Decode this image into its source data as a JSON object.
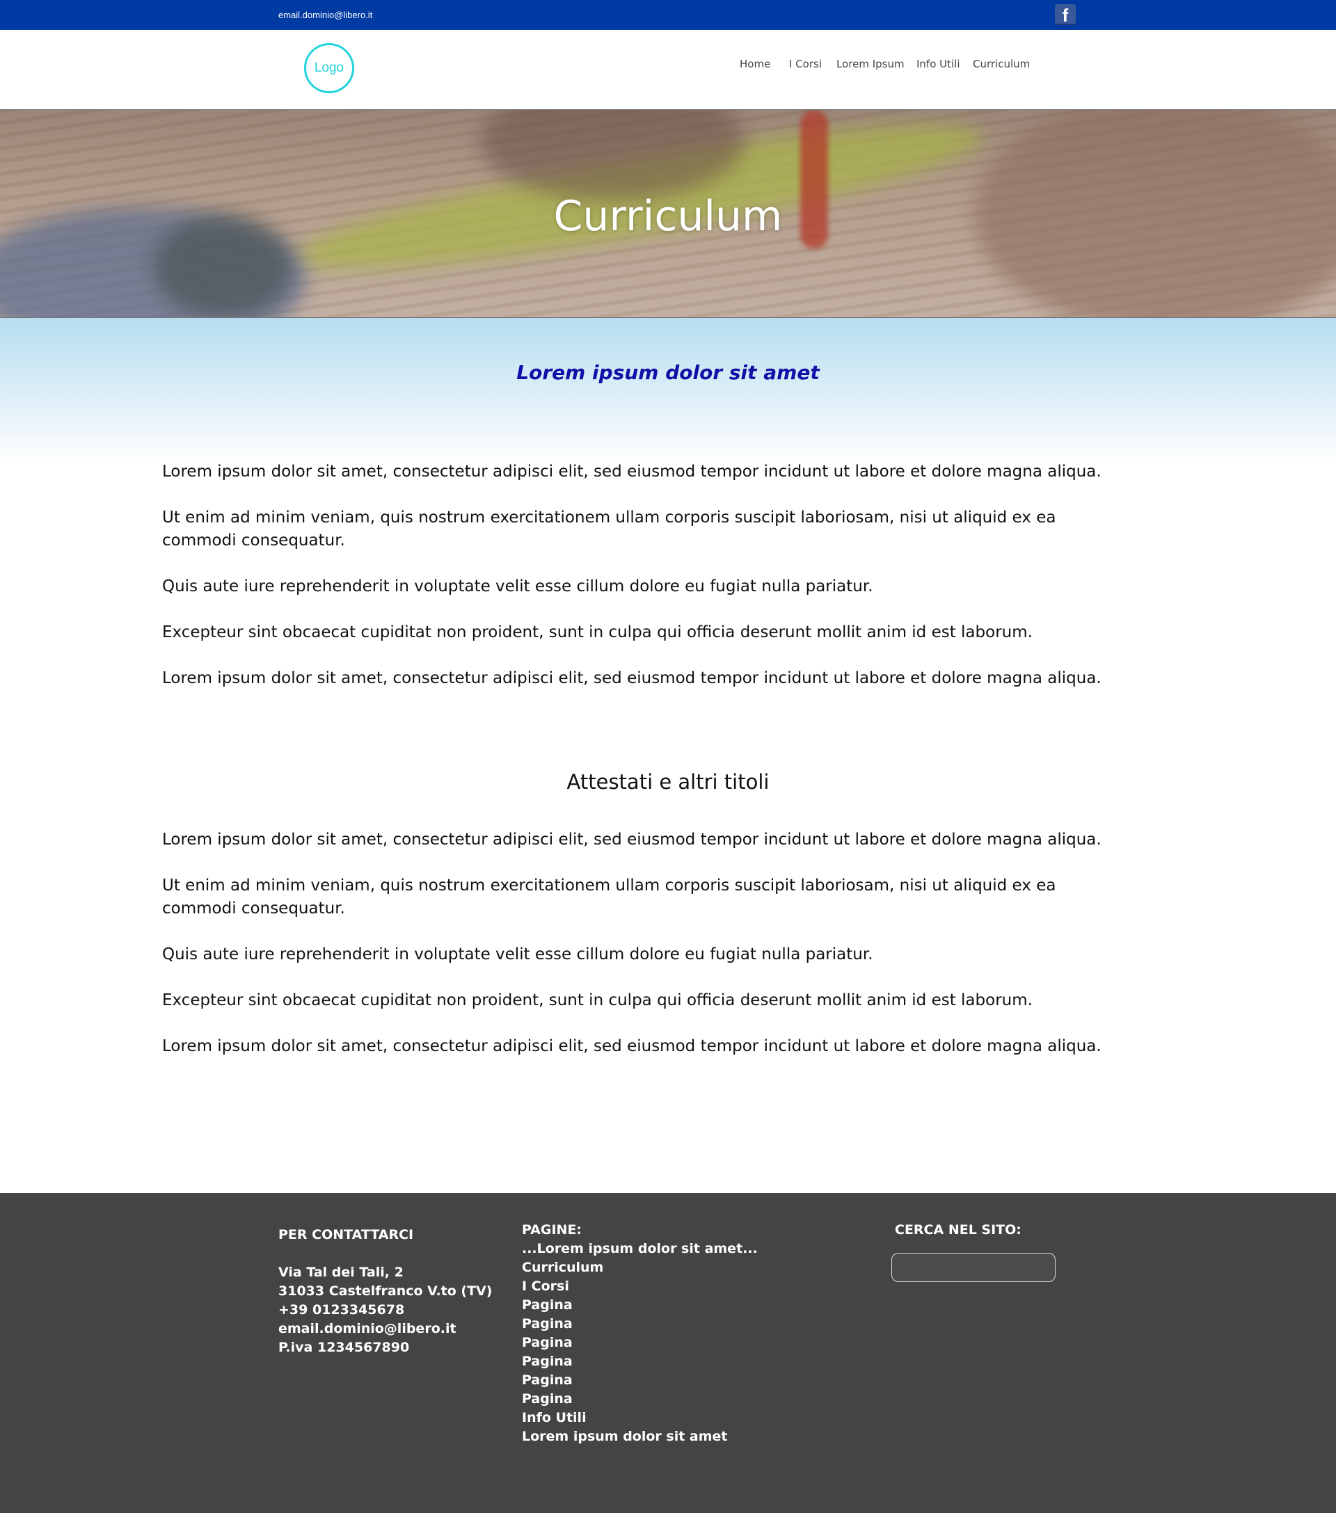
{
  "topbar": {
    "email": "email.dominio@libero.it",
    "social_icon": "facebook-icon",
    "social_glyph": "f"
  },
  "header": {
    "logo_text": "Logo",
    "nav": [
      {
        "label": "Home"
      },
      {
        "label": "I Corsi"
      },
      {
        "label": "Lorem Ipsum"
      },
      {
        "label": "Info Utili"
      },
      {
        "label": "Curriculum"
      }
    ]
  },
  "hero": {
    "title": "Curriculum"
  },
  "main": {
    "subtitle": "Lorem ipsum dolor sit amet",
    "paragraphs": [
      "Lorem ipsum dolor sit amet, consectetur adipisci elit, sed eiusmod tempor incidunt ut labore et dolore magna aliqua.",
      "Ut enim ad minim veniam, quis nostrum exercitationem ullam corporis suscipit laboriosam, nisi ut aliquid ex ea commodi consequatur.",
      "Quis aute iure reprehenderit in voluptate velit esse cillum dolore eu fugiat nulla pariatur.",
      "Excepteur sint obcaecat cupiditat non proident, sunt in culpa qui officia deserunt mollit anim id est laborum.",
      "Lorem ipsum dolor sit amet, consectetur adipisci elit, sed eiusmod tempor incidunt ut labore et dolore magna aliqua."
    ],
    "section_heading": "Attestati e altri titoli",
    "section_paragraphs": [
      "Lorem ipsum dolor sit amet, consectetur adipisci elit, sed eiusmod tempor incidunt ut labore et dolore magna aliqua.",
      "Ut enim ad minim veniam, quis nostrum exercitationem ullam corporis suscipit laboriosam, nisi ut aliquid ex ea commodi consequatur.",
      "Quis aute iure reprehenderit in voluptate velit esse cillum dolore eu fugiat nulla pariatur.",
      "Excepteur sint obcaecat cupiditat non proident, sunt in culpa qui officia deserunt mollit anim id est laborum.",
      "Lorem ipsum dolor sit amet, consectetur adipisci elit, sed eiusmod tempor incidunt ut labore et dolore magna aliqua."
    ]
  },
  "footer": {
    "contact": {
      "heading": "PER CONTATTARCI",
      "lines": [
        "Via Tal dei Tali, 2",
        "31033 Castelfranco V.to (TV)",
        "+39 0123345678",
        "email.dominio@libero.it",
        "P.iva 1234567890"
      ]
    },
    "pages": {
      "heading": "PAGINE:",
      "links": [
        "...Lorem ipsum dolor sit amet...",
        "Curriculum",
        "I Corsi",
        "Pagina",
        "Pagina",
        "Pagina",
        "Pagina",
        "Pagina",
        "Pagina",
        "Info Utili",
        "Lorem ipsum dolor sit amet"
      ]
    },
    "search": {
      "heading": "CERCA NEL SITO:",
      "value": ""
    }
  },
  "colors": {
    "topbar": "#003aa3",
    "logo_accent": "#22d3dc",
    "subtitle": "#1010a6",
    "band_top": "#b7def0",
    "footer_bg": "#444444"
  }
}
